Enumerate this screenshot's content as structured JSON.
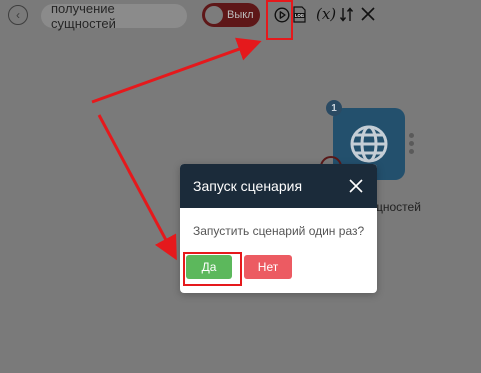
{
  "toolbar": {
    "scenario_name": "получение сущностей",
    "toggle_label": "Выкл",
    "log_label": "LOG",
    "variables_label": "(x)"
  },
  "canvas": {
    "node_badge": "1",
    "node_caption": "ущностей"
  },
  "modal": {
    "title": "Запуск сценария",
    "message": "Запустить сценарий один раз?",
    "yes_label": "Да",
    "no_label": "Нет"
  },
  "colors": {
    "overlay": "#7a7a7a",
    "modal_header": "#1b2b3a",
    "yes_button": "#5cb85c",
    "no_button": "#ec5b62",
    "annotation": "#e5191c"
  },
  "icons": [
    "back-arrow-icon",
    "play-icon",
    "log-icon",
    "variables-icon",
    "sort-icon",
    "close-icon",
    "globe-icon",
    "more-dots-icon"
  ]
}
